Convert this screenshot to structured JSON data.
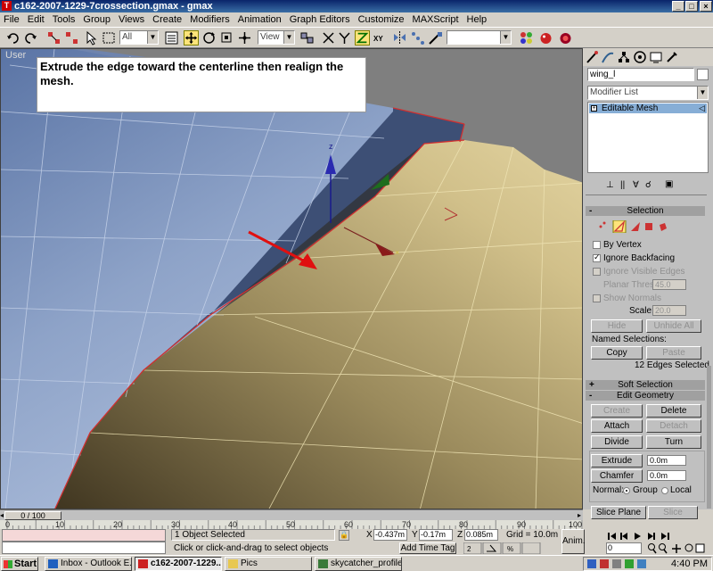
{
  "window": {
    "title": "c162-2007-1229-7crossection.gmax - gmax",
    "minimize": "_",
    "maximize": "□",
    "close": "×"
  },
  "menu": [
    "File",
    "Edit",
    "Tools",
    "Group",
    "Views",
    "Create",
    "Modifiers",
    "Animation",
    "Graph Editors",
    "Customize",
    "MAXScript",
    "Help"
  ],
  "toolbar": {
    "selection_filter": "All",
    "ref_coord": "View"
  },
  "viewport": {
    "label": "User",
    "annotation": "Extrude the edge toward the centerline then realign the mesh."
  },
  "command_panel": {
    "object_name": "wing_l",
    "modifier_list_label": "Modifier List",
    "stack_item": "Editable Mesh",
    "selection": {
      "header": "Selection",
      "minus": "-",
      "by_vertex": "By Vertex",
      "ignore_backfacing": "Ignore Backfacing",
      "ignore_visible_edges": "Ignore Visible Edges",
      "planar_thresh_label": "Planar Thresh",
      "planar_thresh_value": "45.0",
      "show_normals": "Show Normals",
      "scale_label": "Scale:",
      "scale_value": "20.0",
      "hide": "Hide",
      "unhide_all": "Unhide All",
      "named_selections": "Named Selections:",
      "copy": "Copy",
      "paste": "Paste",
      "status": "12 Edges Selected"
    },
    "soft_selection": {
      "header": "Soft Selection",
      "plus": "+"
    },
    "edit_geometry": {
      "header": "Edit Geometry",
      "minus": "-",
      "create": "Create",
      "delete": "Delete",
      "attach": "Attach",
      "detach": "Detach",
      "divide": "Divide",
      "turn": "Turn",
      "extrude": "Extrude",
      "extrude_value": "0.0m",
      "chamfer": "Chamfer",
      "chamfer_value": "0.0m",
      "normal_label": "Normal:",
      "group": "Group",
      "local": "Local",
      "slice_plane": "Slice Plane",
      "slice": "Slice"
    }
  },
  "timeline": {
    "thumb": "0 / 100",
    "ticks": [
      "0",
      "10",
      "20",
      "30",
      "40",
      "50",
      "60",
      "70",
      "80",
      "90",
      "100"
    ]
  },
  "status": {
    "selected": "1 Object Selected",
    "prompt": "Click or click-and-drag to select objects",
    "x_label": "X",
    "x_value": "-0.437m",
    "y_label": "Y",
    "y_value": "-0.17m",
    "z_label": "Z",
    "z_value": "0.085m",
    "grid": "Grid = 10.0m",
    "add_time_tag": "Add Time Tag",
    "anim": "Anim.",
    "frame_value": "0"
  },
  "taskbar": {
    "start": "Start",
    "tasks": [
      {
        "label": "Inbox - Outlook E..."
      },
      {
        "label": "c162-2007-1229..."
      },
      {
        "label": "Pics"
      },
      {
        "label": "skycatcher_profile..."
      }
    ],
    "clock": "4:40 PM"
  },
  "colors": {
    "upper_surface": "#8ea3c8",
    "lower_surface": "#c8b77f",
    "selected_edge": "#d03030",
    "accent_yellow": "#fde47a"
  }
}
